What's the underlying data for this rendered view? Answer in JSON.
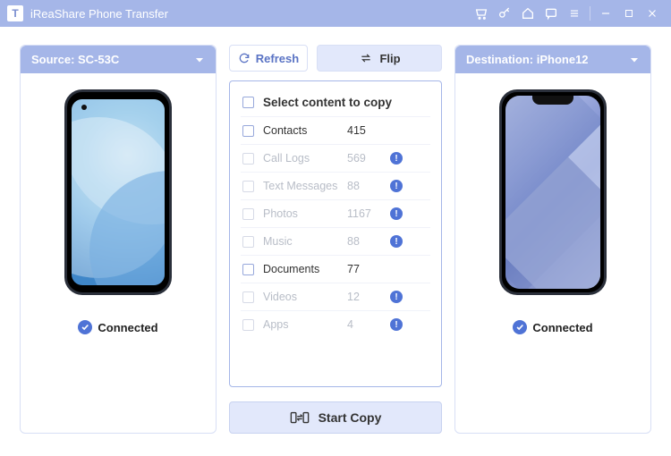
{
  "app": {
    "title": "iReaShare Phone Transfer",
    "logo_letter": "T"
  },
  "source": {
    "label_prefix": "Source: ",
    "device": "SC-53C",
    "status": "Connected"
  },
  "destination": {
    "label_prefix": "Destination: ",
    "device": "iPhone12",
    "status": "Connected"
  },
  "actions": {
    "refresh": "Refresh",
    "flip": "Flip",
    "start": "Start Copy"
  },
  "list": {
    "header": "Select content to copy",
    "items": [
      {
        "label": "Contacts",
        "count": "415",
        "enabled": true,
        "warn": false
      },
      {
        "label": "Call Logs",
        "count": "569",
        "enabled": false,
        "warn": true
      },
      {
        "label": "Text Messages",
        "count": "88",
        "enabled": false,
        "warn": true
      },
      {
        "label": "Photos",
        "count": "1167",
        "enabled": false,
        "warn": true
      },
      {
        "label": "Music",
        "count": "88",
        "enabled": false,
        "warn": true
      },
      {
        "label": "Documents",
        "count": "77",
        "enabled": true,
        "warn": false
      },
      {
        "label": "Videos",
        "count": "12",
        "enabled": false,
        "warn": true
      },
      {
        "label": "Apps",
        "count": "4",
        "enabled": false,
        "warn": true
      }
    ]
  }
}
